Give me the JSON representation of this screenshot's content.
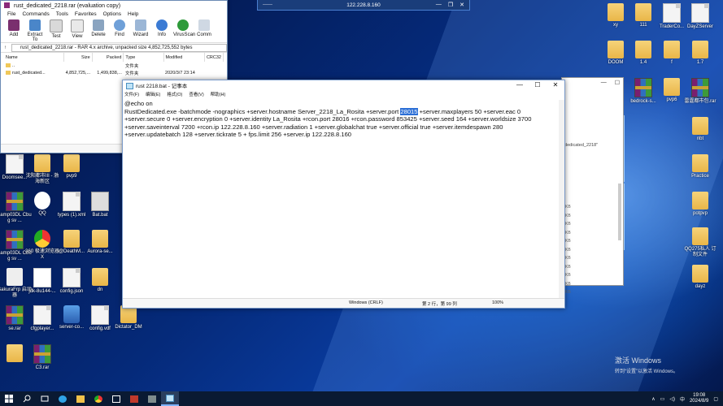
{
  "rdp_bar": {
    "address": "122.228.8.160",
    "left": "——",
    "controls": [
      "—",
      "❐",
      "✕"
    ]
  },
  "winrar": {
    "title": "rust_dedicated_2218.rar (evaluation copy)",
    "menu": [
      "File",
      "Commands",
      "Tools",
      "Favorites",
      "Options",
      "Help"
    ],
    "toolbar": [
      "Add",
      "Extract To",
      "Test",
      "View",
      "Delete",
      "Find",
      "Wizard",
      "Info",
      "VirusScan",
      "Comm"
    ],
    "path": "rust_dedicated_2218.rar - RAR 4.x archive, unpacked size 4,852,725,552 bytes",
    "columns": [
      "Name",
      "Size",
      "Packed",
      "Type",
      "Modified",
      "CRC32"
    ],
    "rows": [
      {
        "name": "..",
        "size": "",
        "packed": "",
        "type": "文件夹",
        "modified": ""
      },
      {
        "name": "rust_dedicated...",
        "size": "4,852,725,...",
        "packed": "1,499,838,...",
        "type": "文件夹",
        "modified": "2020/3/7 23:14"
      }
    ]
  },
  "notepad": {
    "title": "rust 2218.bat - 记事本",
    "menu": [
      "文件(F)",
      "编辑(E)",
      "格式(O)",
      "查看(V)",
      "帮助(H)"
    ],
    "line1": "@echo on",
    "text_before": "RustDedicated.exe -batchmode -nographics +server.hostname Server_2218_La_Rosita +server.port ",
    "selected": "28015",
    "text_after": " +server.maxplayers 50 +server.eac 0 +server.secure 0 +server.encryption 0 +server.identity La_Rosita +rcon.port 28016 +rcon.password 853425 +server.seed 164 +server.worldsize 3700 +server.saveinterval 7200 +rcon.ip 122.228.8.160 +server.radiation 1 +server.globalchat true +server.official true +server.itemdespawn 280 +server.updatebatch 128 +server.tickrate 5 + fps.limit 256 +server.ip 122.228.8.160",
    "status": {
      "encoding": "Windows (CRLF)",
      "position": "第 2 行，第 99 列",
      "zoom": "100%"
    }
  },
  "bg_explorer": {
    "fragment": "_dedicated_2218\"",
    "kb": [
      "KB",
      "KB",
      "KB",
      "KB",
      "KB",
      "KB",
      "KB",
      "KB",
      "KB",
      "KB",
      "KB"
    ]
  },
  "desktop_left": [
    {
      "label": "Doomsee...",
      "kind": "file"
    },
    {
      "label": "沈阳都市III - 渤海新区",
      "kind": "folder"
    },
    {
      "label": "pvp9",
      "kind": "folder"
    },
    {
      "label": "samp03DL Cbug sv ...",
      "kind": "rar"
    },
    {
      "label": "QQ",
      "kind": "qq"
    },
    {
      "label": "types (1).xml",
      "kind": "file"
    },
    {
      "label": "Bat.bat",
      "kind": "bat"
    },
    {
      "label": "samp03DL Cbug sv ...",
      "kind": "rar"
    },
    {
      "label": "360 极速浏览器X",
      "kind": "chrome"
    },
    {
      "label": "@DeathM...",
      "kind": "folder"
    },
    {
      "label": "Aurora-se...",
      "kind": "folder"
    },
    {
      "label": "SakuraFrp 启动器",
      "kind": "sakura"
    },
    {
      "label": "jdk-8u144-...",
      "kind": "java"
    },
    {
      "label": "config.json",
      "kind": "file"
    },
    {
      "label": "dn",
      "kind": "folder"
    },
    {
      "label": "se.rar",
      "kind": "rar"
    },
    {
      "label": "cfgplayer...",
      "kind": "file"
    },
    {
      "label": "server-co...",
      "kind": "app"
    },
    {
      "label": "config.vdf",
      "kind": "file"
    },
    {
      "label": "Dictator_DM",
      "kind": "folder"
    },
    {
      "label": "",
      "kind": "folder"
    },
    {
      "label": "C3.rar",
      "kind": "rar"
    }
  ],
  "desktop_right": [
    {
      "label": "xy",
      "kind": "folder"
    },
    {
      "label": "111",
      "kind": "folder"
    },
    {
      "label": "TraderCo...",
      "kind": "file"
    },
    {
      "label": "DayZServer",
      "kind": "file"
    },
    {
      "label": "DOOM",
      "kind": "folder"
    },
    {
      "label": "1.4",
      "kind": "folder"
    },
    {
      "label": "f",
      "kind": "folder"
    },
    {
      "label": "1.7",
      "kind": "folder"
    },
    {
      "label": "bedrock-s...",
      "kind": "rar"
    },
    {
      "label": "pvp6",
      "kind": "folder"
    },
    {
      "label": "雷霆都市包.rar",
      "kind": "rar"
    },
    {
      "label": "nbt",
      "kind": "folder"
    },
    {
      "label": "Practice",
      "kind": "folder"
    },
    {
      "label": "potpvp",
      "kind": "folder"
    },
    {
      "label": "QQ275私人 订制文件",
      "kind": "folder"
    },
    {
      "label": "dayz",
      "kind": "folder"
    }
  ],
  "watermark": {
    "line1": "激活 Windows",
    "line2": "转到“设置”以激活 Windows。"
  },
  "taskbar": {
    "apps": [
      "start",
      "search",
      "task-view",
      "edge",
      "file-explorer",
      "chrome-360",
      "app-1",
      "app-2",
      "app-3",
      "notepad"
    ],
    "clock_time": "19:08",
    "clock_date": "2024/8/9",
    "ime": "中"
  }
}
